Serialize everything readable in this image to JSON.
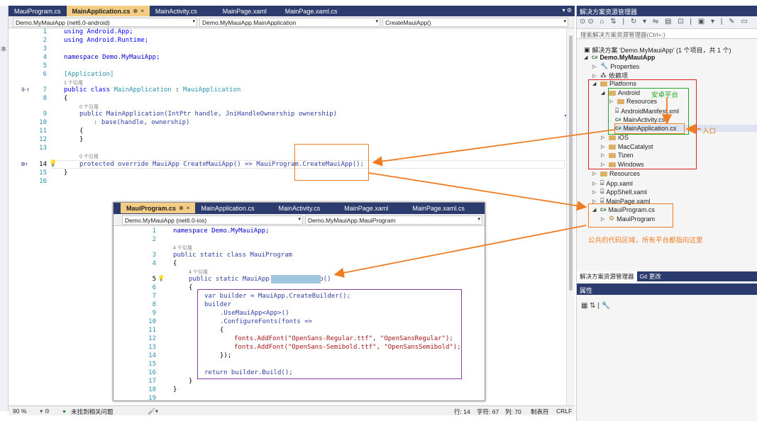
{
  "main_tabs": [
    {
      "label": "MauiProgram.cs",
      "active": false
    },
    {
      "label": "MainApplication.cs",
      "active": true,
      "pin": "⊕",
      "close": "×"
    },
    {
      "label": "MainActivity.cs",
      "active": false
    },
    {
      "label": "MainPage.xaml",
      "active": false
    },
    {
      "label": "MainPage.xaml.cs",
      "active": false
    }
  ],
  "main_nav": {
    "project": "Demo.MyMauiApp (net6.0-android)",
    "type": "Demo.MyMauiApp.MainApplication",
    "member": "CreateMauiApp()"
  },
  "main_code": {
    "ln1": "1",
    "l1": "using Android.App;",
    "ln2": "2",
    "l2": "using Android.Runtime;",
    "ln3": "3",
    "ln4": "4",
    "l4": "namespace Demo.MyMauiApp;",
    "ln5": "5",
    "ln6": "6",
    "l6": "[Application]",
    "ref1": "1 个引用",
    "ln7": "7",
    "l7a": "public class ",
    "l7b": "MainApplication",
    "l7c": " : ",
    "l7d": "MauiApplication",
    "ln8": "8",
    "l8": "{",
    "ref2": "0 个引用",
    "ln9": "9",
    "l9": "public MainApplication(IntPtr handle, JniHandleOwnership ownership)",
    "ln10": "10",
    "l10": ": base(handle, ownership)",
    "ln11": "11",
    "l11": "{",
    "ln12": "12",
    "l12": "}",
    "ln13": "13",
    "ref3": "0 个引用",
    "ln14": "14",
    "l14": "protected override MauiApp CreateMauiApp() => MauiProgram.CreateMauiApp();",
    "ln15": "15",
    "l15": "}",
    "ln16": "16"
  },
  "status": {
    "zoom": "90 %",
    "issues": "未找到相关问题",
    "line": "行: 14",
    "char": "字符: 67",
    "col": "列: 70",
    "tabs": "制表符",
    "eol": "CRLF"
  },
  "overlay_tabs": [
    {
      "label": "MauiProgram.cs",
      "active": true,
      "pin": "⊕",
      "close": "×"
    },
    {
      "label": "MainApplication.cs",
      "active": false
    },
    {
      "label": "MainActivity.cs",
      "active": false
    },
    {
      "label": "MainPage.xaml",
      "active": false
    },
    {
      "label": "MainPage.xaml.cs",
      "active": false
    }
  ],
  "overlay_nav": {
    "project": "Demo.MyMauiApp (net6.0-ios)",
    "type": "Demo.MyMauiApp.MauiProgram"
  },
  "overlay_code": {
    "ln1": "1",
    "l1": "namespace Demo.MyMauiApp;",
    "ln2": "2",
    "ref1": "4 个引用",
    "ln3": "3",
    "l3": "public static class MauiProgram",
    "ln4": "4",
    "l4": "{",
    "ref2": "4 个引用",
    "ln5": "5",
    "l5": "public static MauiApp CreateMauiApp()",
    "ln6": "6",
    "l6": "{",
    "ln7": "7",
    "l7": "var builder = MauiApp.CreateBuilder();",
    "ln8": "8",
    "l8": "builder",
    "ln9": "9",
    "l9": ".UseMauiApp<App>()",
    "ln10": "10",
    "l10": ".ConfigureFonts(fonts =>",
    "ln11": "11",
    "l11": "{",
    "ln12": "12",
    "l12": "fonts.AddFont(\"OpenSans-Regular.ttf\", \"OpenSansRegular\");",
    "ln13": "13",
    "l13": "fonts.AddFont(\"OpenSans-Semibold.ttf\", \"OpenSansSemibold\");",
    "ln14": "14",
    "l14": "});",
    "ln15": "15",
    "ln16": "16",
    "l16": "return builder.Build();",
    "ln17": "17",
    "l17": "}",
    "ln18": "18",
    "l18": "}",
    "ln19": "19"
  },
  "solution_explorer": {
    "title": "解决方案资源管理器",
    "search_placeholder": "搜索解决方案资源管理器(Ctrl+;)",
    "solution": "解决方案 'Demo.MyMauiApp' (1 个项目，共 1 个)",
    "project": "Demo.MyMauiApp",
    "items": {
      "properties": "Properties",
      "deps": "依赖项",
      "platforms": "Platforms",
      "android": "Android",
      "resources_android": "Resources",
      "manifest": "AndroidManifest.xml",
      "mainactivity": "MainActivity.cs",
      "mainapplication": "MainApplication.cs",
      "ios": "iOS",
      "maccatalyst": "MacCatalyst",
      "tizen": "Tizen",
      "windows": "Windows",
      "resources": "Resources",
      "appxaml": "App.xaml",
      "appshell": "AppShell.xaml",
      "mainpage": "MainPage.xaml",
      "mauiprogram": "MauiProgram.cs",
      "mauiprogram_class": "MauiProgram"
    },
    "bottom_tabs": [
      "解决方案资源管理器",
      "Git 更改"
    ],
    "properties_title": "属性"
  },
  "annotations": {
    "android_platform": "安卓平台",
    "entry": "入口",
    "shared_code": "公共的代码区域，所有平台都指向这里"
  },
  "colors": {
    "title_bar": "#2b3b6e",
    "active_tab": "#f5cc84",
    "annotation_orange": "#f07c22",
    "annotation_red": "#e02020",
    "annotation_green": "#22a822",
    "annotation_purple": "#8a3a9a"
  }
}
